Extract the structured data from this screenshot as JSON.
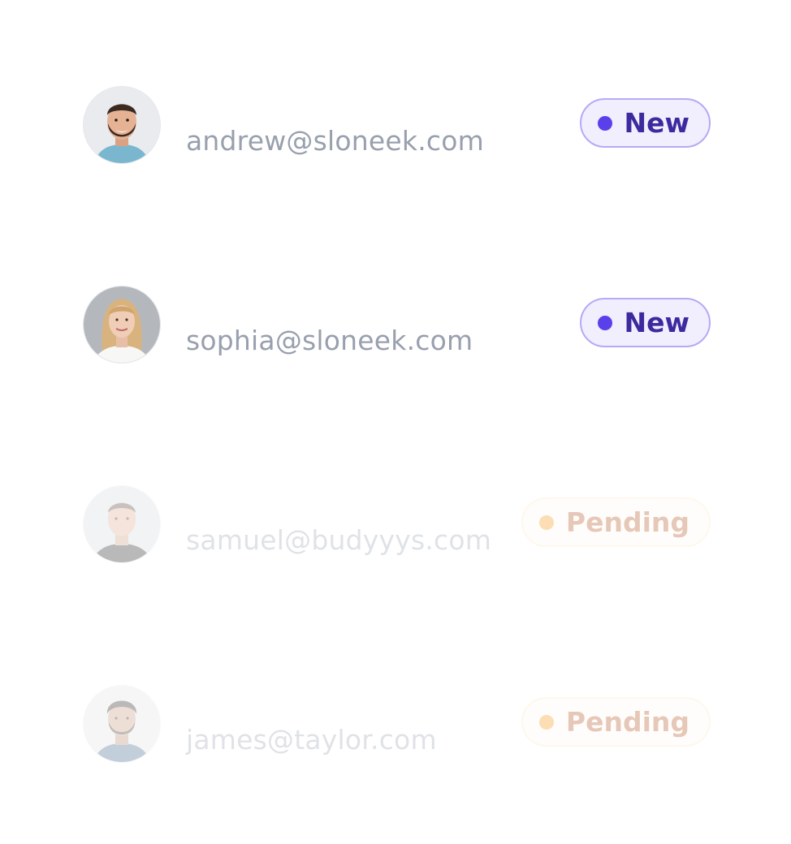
{
  "contacts": [
    {
      "email": "andrew@sloneek.com",
      "status": "New",
      "status_type": "new",
      "faded": false
    },
    {
      "email": "sophia@sloneek.com",
      "status": "New",
      "status_type": "new",
      "faded": false
    },
    {
      "email": "samuel@budyyys.com",
      "status": "Pending",
      "status_type": "pending",
      "faded": true
    },
    {
      "email": "james@taylor.com",
      "status": "Pending",
      "status_type": "pending",
      "faded": true
    }
  ],
  "colors": {
    "new_bg": "#f1eefe",
    "new_border": "#b6a9f6",
    "new_text": "#3c2a9e",
    "new_dot": "#5a40ea",
    "pending_bg": "#fffaf3",
    "pending_border": "#fde7c6",
    "pending_text": "#b04b16",
    "pending_dot": "#f79009",
    "email_text": "#98a0ae"
  }
}
